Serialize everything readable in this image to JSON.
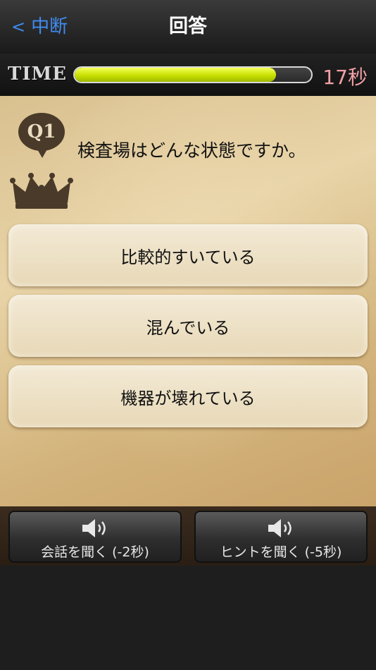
{
  "nav": {
    "back_label": "中断",
    "back_chevron": "<",
    "title": "回答"
  },
  "timer": {
    "label": "TIME",
    "remaining": "17秒",
    "progress_fraction": 0.85
  },
  "question": {
    "badge": "Q1",
    "text": "検査場はどんな状態ですか。"
  },
  "choices": [
    {
      "label": "比較的すいている"
    },
    {
      "label": "混んでいる"
    },
    {
      "label": "機器が壊れている"
    }
  ],
  "actions": {
    "listen_conversation": "会話を聞く (-2秒)",
    "listen_hint": "ヒントを聞く (-5秒)"
  },
  "colors": {
    "accent_blue": "#3f8cf0",
    "time_text": "#f3a0a6",
    "progress_fill": "#c8e000"
  },
  "icons": [
    "crown-icon",
    "speaker-icon"
  ]
}
